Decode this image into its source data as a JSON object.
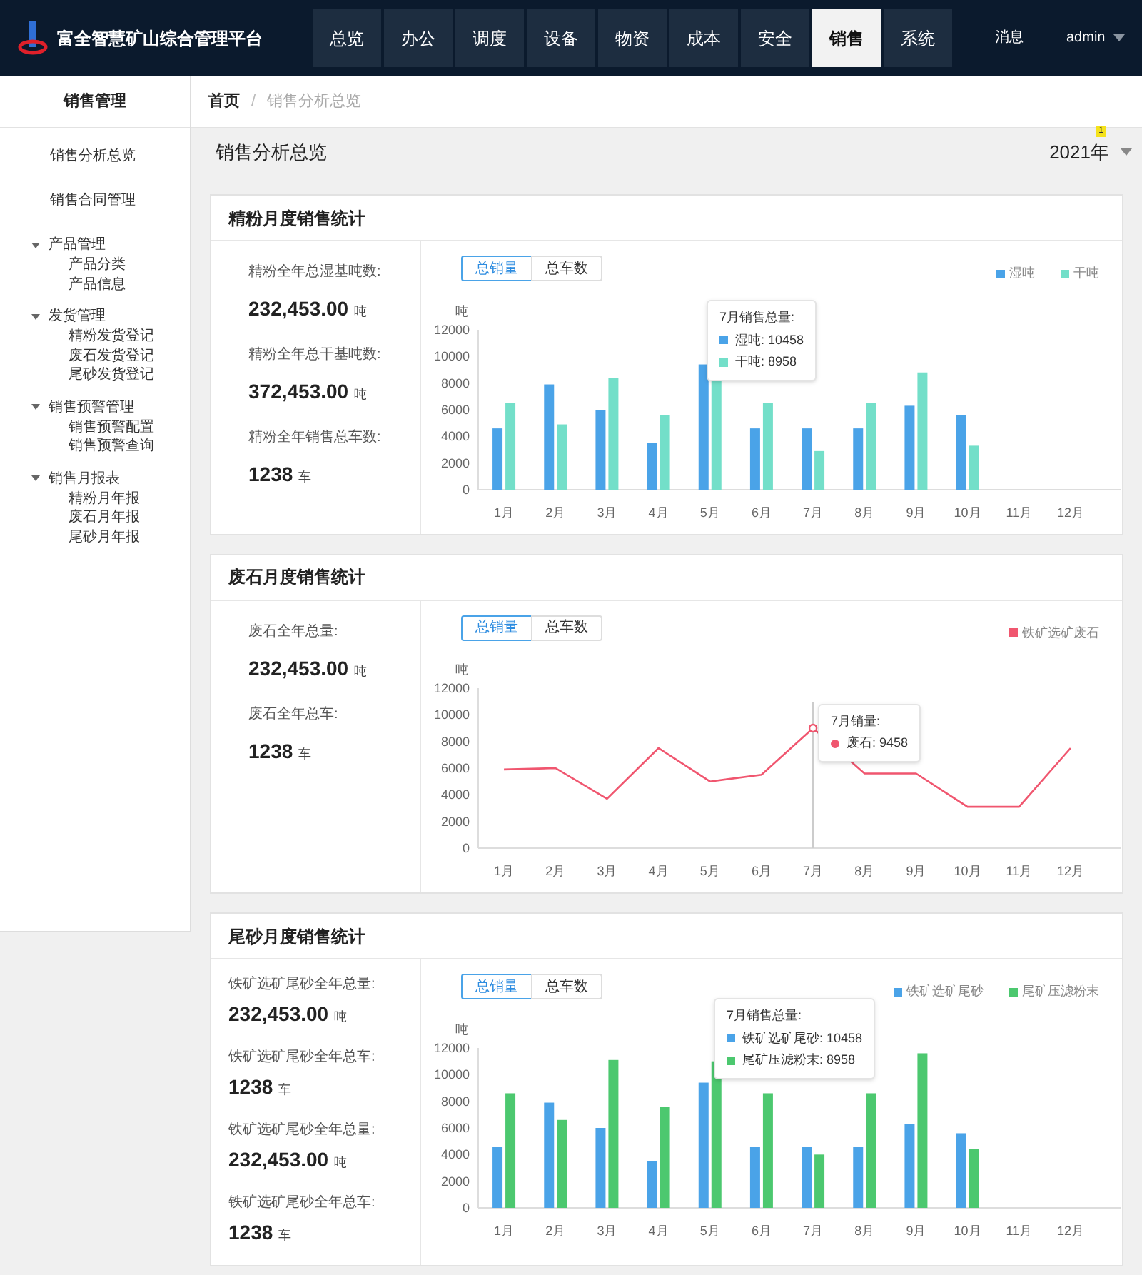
{
  "header": {
    "title": "富全智慧矿山综合管理平台",
    "nav": [
      {
        "label": "总览",
        "selected": false
      },
      {
        "label": "办公",
        "selected": false
      },
      {
        "label": "调度",
        "selected": false
      },
      {
        "label": "设备",
        "selected": false
      },
      {
        "label": "物资",
        "selected": false
      },
      {
        "label": "成本",
        "selected": false
      },
      {
        "label": "安全",
        "selected": false
      },
      {
        "label": "销售",
        "selected": true
      },
      {
        "label": "系统",
        "selected": false
      }
    ],
    "messages": "消息",
    "user": "admin"
  },
  "sidebar": {
    "title": "销售管理",
    "items": [
      {
        "label": "销售分析总览"
      },
      {
        "label": "销售合同管理"
      },
      {
        "label": "产品管理",
        "expanded": true,
        "children": [
          {
            "label": "产品分类"
          },
          {
            "label": "产品信息"
          }
        ]
      },
      {
        "label": "发货管理",
        "expanded": true,
        "children": [
          {
            "label": "精粉发货登记"
          },
          {
            "label": "废石发货登记"
          },
          {
            "label": "尾砂发货登记"
          }
        ]
      },
      {
        "label": "销售预警管理",
        "expanded": true,
        "children": [
          {
            "label": "销售预警配置"
          },
          {
            "label": "销售预警查询"
          }
        ]
      },
      {
        "label": "销售月报表",
        "expanded": true,
        "children": [
          {
            "label": "精粉月年报"
          },
          {
            "label": "废石月年报"
          },
          {
            "label": "尾砂月年报"
          }
        ]
      }
    ]
  },
  "breadcrumb": [
    "首页",
    "销售分析总览"
  ],
  "breadcrumb_separator": "/",
  "page_title": "销售分析总览",
  "year": "2021年",
  "year_badge": "1",
  "cards": [
    {
      "title": "精粉月度销售统计",
      "stats": [
        {
          "label": "精粉全年总湿基吨数:",
          "value": "232,453.00",
          "unit": "吨"
        },
        {
          "label": "精粉全年总干基吨数:",
          "value": "372,453.00",
          "unit": "吨"
        },
        {
          "label": "精粉全年销售总车数:",
          "value": "1238",
          "unit": "车"
        }
      ],
      "toggle": [
        {
          "label": "总销量",
          "selected": true
        },
        {
          "label": "总车数",
          "selected": false
        }
      ],
      "tooltip": {
        "title": "7月销售总量:",
        "rows": [
          {
            "label": "湿吨:",
            "value": "10458",
            "color": "#4aa3e8"
          },
          {
            "label": "干吨:",
            "value": "8958",
            "color": "#73dfc9"
          }
        ]
      },
      "chart_data": {
        "type": "bar",
        "ylabel": "吨",
        "categories": [
          "1月",
          "2月",
          "3月",
          "4月",
          "5月",
          "6月",
          "7月",
          "8月",
          "9月",
          "10月",
          "11月",
          "12月"
        ],
        "ylim": [
          0,
          12000
        ],
        "yticks": [
          0,
          2000,
          4000,
          6000,
          8000,
          10000,
          12000
        ],
        "series": [
          {
            "name": "湿吨",
            "color": "#4aa3e8",
            "values": [
              4600,
              7900,
              6000,
              3500,
              9400,
              4600,
              4600,
              4600,
              6300,
              5600,
              null,
              null
            ]
          },
          {
            "name": "干吨",
            "color": "#73dfc9",
            "values": [
              6500,
              4900,
              8400,
              5600,
              8300,
              6500,
              2900,
              6500,
              8800,
              3300,
              null,
              null
            ]
          }
        ]
      }
    },
    {
      "title": "废石月度销售统计",
      "stats": [
        {
          "label": "废石全年总量:",
          "value": "232,453.00",
          "unit": "吨"
        },
        {
          "label": "废石全年总车:",
          "value": "1238",
          "unit": "车"
        }
      ],
      "toggle": [
        {
          "label": "总销量",
          "selected": true
        },
        {
          "label": "总车数",
          "selected": false
        }
      ],
      "tooltip": {
        "title": "7月销量:",
        "rows": [
          {
            "label": "废石:",
            "value": "9458",
            "color": "#f0566f"
          }
        ]
      },
      "chart_data": {
        "type": "line",
        "ylabel": "吨",
        "categories": [
          "1月",
          "2月",
          "3月",
          "4月",
          "5月",
          "6月",
          "7月",
          "8月",
          "9月",
          "10月",
          "11月",
          "12月"
        ],
        "ylim": [
          0,
          12000
        ],
        "yticks": [
          0,
          2000,
          4000,
          6000,
          8000,
          10000,
          12000
        ],
        "annotations": [
          {
            "x": "7月"
          }
        ],
        "series": [
          {
            "name": "铁矿选矿废石",
            "color": "#f0566f",
            "values": [
              5900,
              6000,
              3700,
              7500,
              5000,
              5500,
              9000,
              5600,
              5600,
              3100,
              3100,
              7500
            ]
          }
        ]
      }
    },
    {
      "title": "尾砂月度销售统计",
      "stats": [
        {
          "label": "铁矿选矿尾砂全年总量:",
          "value": "232,453.00",
          "unit": "吨"
        },
        {
          "label": "铁矿选矿尾砂全年总车:",
          "value": "1238",
          "unit": "车"
        },
        {
          "label": "铁矿选矿尾砂全年总量:",
          "value": "232,453.00",
          "unit": "吨"
        },
        {
          "label": "铁矿选矿尾砂全年总车:",
          "value": "1238",
          "unit": "车"
        }
      ],
      "toggle": [
        {
          "label": "总销量",
          "selected": true
        },
        {
          "label": "总车数",
          "selected": false
        }
      ],
      "tooltip": {
        "title": "7月销售总量:",
        "rows": [
          {
            "label": "铁矿选矿尾砂:",
            "value": "10458",
            "color": "#4aa3e8"
          },
          {
            "label": "尾矿压滤粉末:",
            "value": "8958",
            "color": "#4cc86f"
          }
        ]
      },
      "chart_data": {
        "type": "bar",
        "ylabel": "吨",
        "categories": [
          "1月",
          "2月",
          "3月",
          "4月",
          "5月",
          "6月",
          "7月",
          "8月",
          "9月",
          "10月",
          "11月",
          "12月"
        ],
        "ylim": [
          0,
          12000
        ],
        "yticks": [
          0,
          2000,
          4000,
          6000,
          8000,
          10000,
          12000
        ],
        "series": [
          {
            "name": "铁矿选矿尾砂",
            "color": "#4aa3e8",
            "values": [
              4600,
              7900,
              6000,
              3500,
              9400,
              4600,
              4600,
              4600,
              6300,
              5600,
              null,
              null
            ]
          },
          {
            "name": "尾矿压滤粉末",
            "color": "#4cc86f",
            "values": [
              8600,
              6600,
              11100,
              7600,
              11000,
              8600,
              4000,
              8600,
              11600,
              4400,
              null,
              null
            ]
          }
        ]
      }
    }
  ]
}
